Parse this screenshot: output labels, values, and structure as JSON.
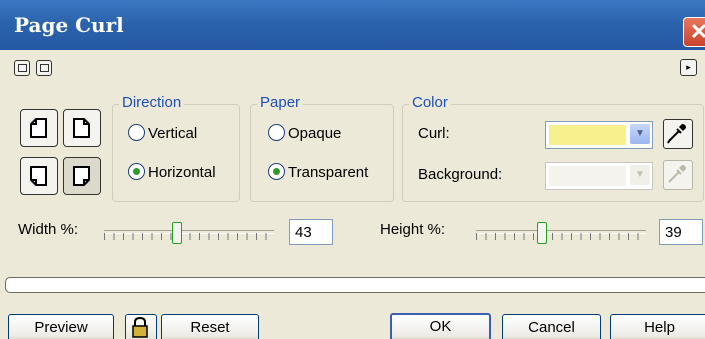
{
  "window": {
    "title": "Page Curl",
    "close_symbol": "✕"
  },
  "toolbar": {
    "expand_symbol": "▸"
  },
  "direction": {
    "legend": "Direction",
    "vertical": "Vertical",
    "horizontal": "Horizontal",
    "selected": "Horizontal"
  },
  "paper": {
    "legend": "Paper",
    "opaque": "Opaque",
    "transparent": "Transparent",
    "selected": "Transparent"
  },
  "color": {
    "legend": "Color",
    "curl_label": "Curl:",
    "curl_color": "#f7f08c",
    "background_label": "Background:",
    "background_color": "#f4f3ee"
  },
  "width": {
    "label": "Width %:",
    "value": "43",
    "fraction": 0.43
  },
  "height": {
    "label": "Height %:",
    "value": "39",
    "fraction": 0.39
  },
  "buttons": {
    "preview": "Preview",
    "reset": "Reset",
    "ok": "OK",
    "cancel": "Cancel",
    "help": "Help"
  }
}
